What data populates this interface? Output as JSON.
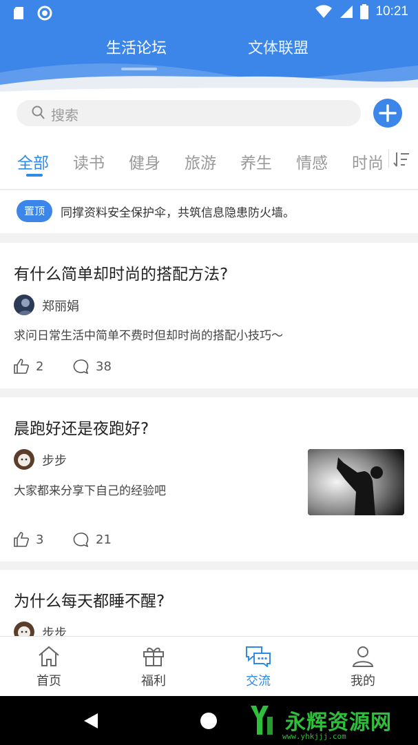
{
  "status_bar": {
    "time": "10:21"
  },
  "top_tabs": [
    {
      "label": "生活论坛",
      "active": true
    },
    {
      "label": "文体联盟",
      "active": false
    }
  ],
  "search": {
    "placeholder": "搜索"
  },
  "categories": [
    {
      "label": "全部",
      "active": true
    },
    {
      "label": "读书"
    },
    {
      "label": "健身"
    },
    {
      "label": "旅游"
    },
    {
      "label": "养生"
    },
    {
      "label": "情感"
    },
    {
      "label": "时尚"
    }
  ],
  "pinned": {
    "badge": "置顶",
    "text": "同撑资料安全保护伞，共筑信息隐患防火墙。"
  },
  "posts": [
    {
      "title": "有什么简单却时尚的搭配方法?",
      "author": "郑丽娟",
      "excerpt": "求问日常生活中简单不费时但却时尚的搭配小技巧～",
      "likes": "2",
      "comments": "38"
    },
    {
      "title": "晨跑好还是夜跑好?",
      "author": "步步",
      "excerpt": "大家都来分享下自己的经验吧",
      "likes": "3",
      "comments": "21"
    },
    {
      "title": "为什么每天都睡不醒?",
      "author": "步步"
    }
  ],
  "bottom_nav": [
    {
      "label": "首页",
      "icon": "home-icon"
    },
    {
      "label": "福利",
      "icon": "gift-icon"
    },
    {
      "label": "交流",
      "icon": "chat-icon",
      "active": true
    },
    {
      "label": "我的",
      "icon": "user-icon"
    }
  ],
  "watermark": {
    "text": "永辉资源网",
    "url": "www.yhkjjj.com"
  },
  "colors": {
    "primary": "#3b86e8",
    "active_tab": "#2d8ae6"
  }
}
